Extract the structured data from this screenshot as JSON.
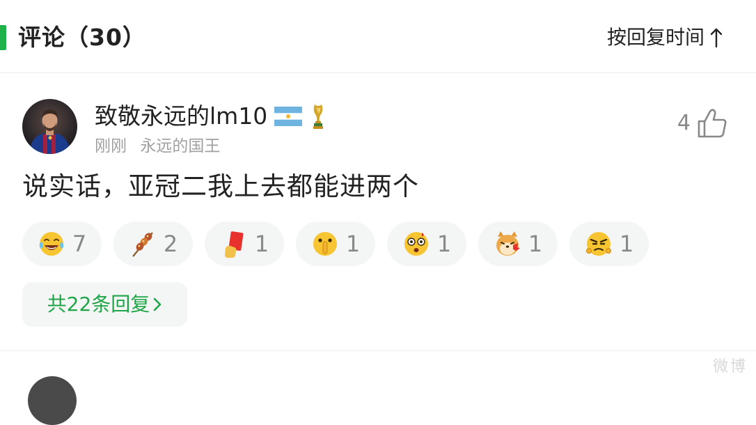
{
  "header": {
    "title": "评论（30）",
    "sort_label": "按回复时间"
  },
  "comment": {
    "username": "致敬永远的lm10",
    "time": "刚刚",
    "tag": "永远的国王",
    "likes": "4",
    "text": "说实话，亚冠二我上去都能进两个",
    "reactions": [
      {
        "icon": "laughing-tears-emoji-icon",
        "count": "7"
      },
      {
        "icon": "meat-skewer-icon",
        "count": "2"
      },
      {
        "icon": "red-card-icon",
        "count": "1"
      },
      {
        "icon": "shush-emoji-icon",
        "count": "1"
      },
      {
        "icon": "dizzy-emoji-icon",
        "count": "1"
      },
      {
        "icon": "shiba-dog-slap-icon",
        "count": "1"
      },
      {
        "icon": "annoyed-emoji-icon",
        "count": "1"
      }
    ],
    "replies_label": "共22条回复"
  },
  "watermark": "微博"
}
